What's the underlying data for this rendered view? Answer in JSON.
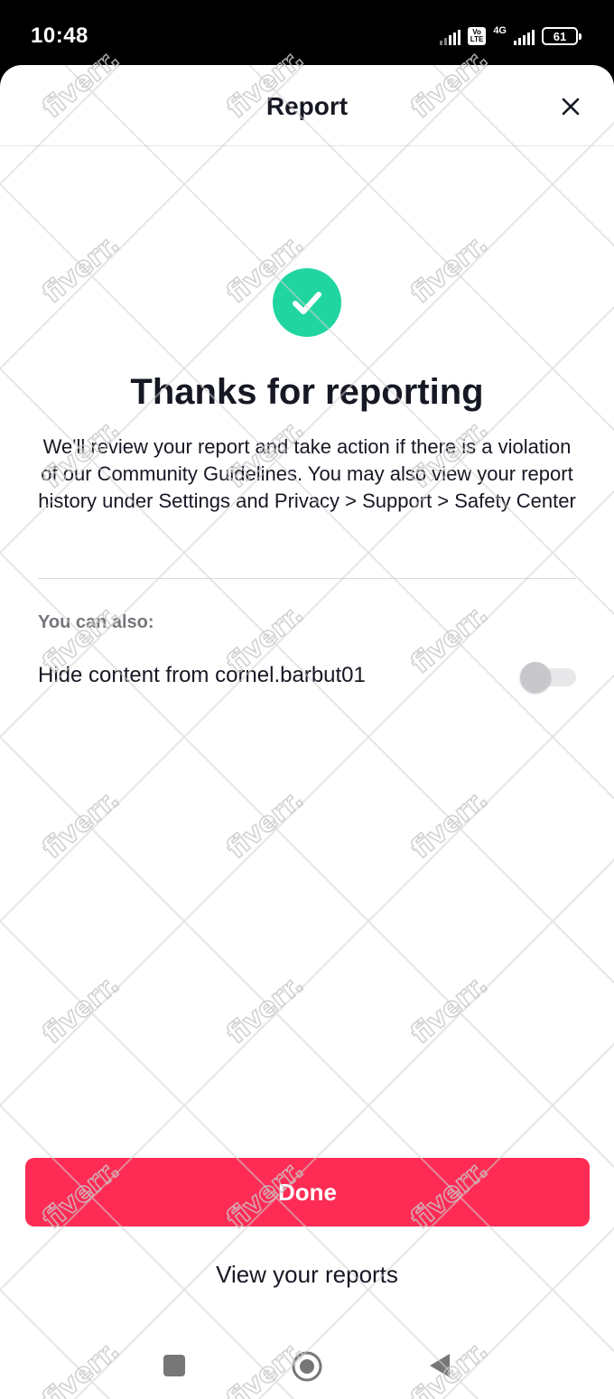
{
  "status_bar": {
    "time": "10:48",
    "volte_top": "Vo",
    "volte_bottom": "LTE",
    "network": "4G",
    "battery": "61"
  },
  "header": {
    "title": "Report"
  },
  "confirmation": {
    "heading": "Thanks for reporting",
    "description": "We'll review your report and take action if there is a violation of our Community Guidelines. You may also view your report history under Settings and Privacy > Support > Safety Center"
  },
  "options": {
    "label": "You can also:",
    "hide_content_label": "Hide content from cornel.barbut01",
    "hide_content_enabled": false
  },
  "actions": {
    "done_label": "Done",
    "view_reports_label": "View your reports"
  },
  "colors": {
    "accent": "#fe2c55",
    "success": "#20d5a0"
  },
  "watermark_text": "fiverr."
}
